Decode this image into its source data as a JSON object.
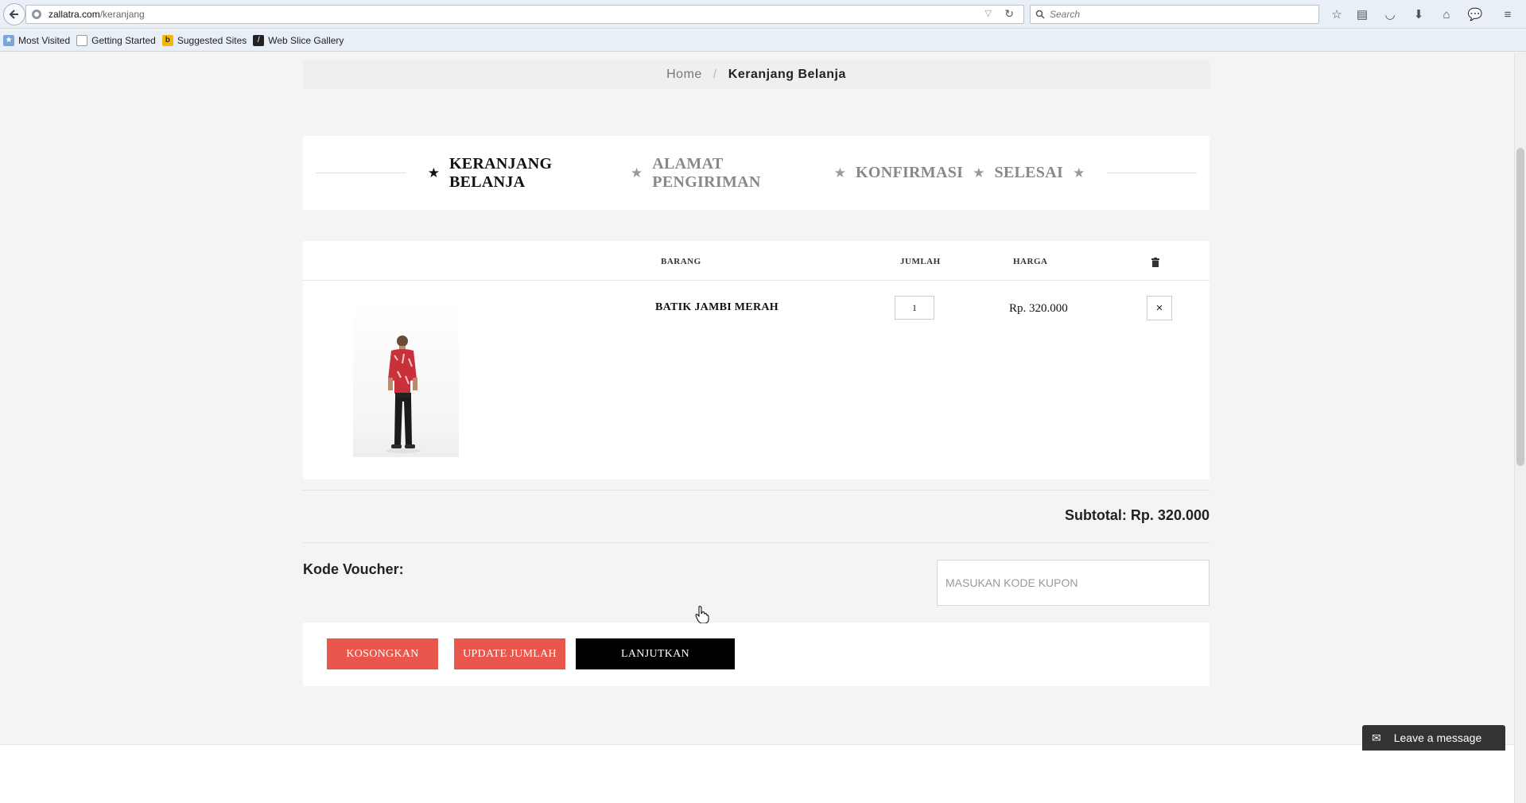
{
  "browser": {
    "url_host": "zallatra.com",
    "url_path": "/keranjang",
    "search_placeholder": "Search",
    "bookmarks": [
      "Most Visited",
      "Getting Started",
      "Suggested Sites",
      "Web Slice Gallery"
    ]
  },
  "breadcrumb": {
    "home": "Home",
    "separator": "/",
    "current": "Keranjang Belanja"
  },
  "steps": [
    {
      "label": "KERANJANG BELANJA",
      "active": true
    },
    {
      "label": "ALAMAT PENGIRIMAN",
      "active": false
    },
    {
      "label": "KONFIRMASI",
      "active": false
    },
    {
      "label": "SELESAI",
      "active": false
    }
  ],
  "cart": {
    "headers": {
      "item": "BARANG",
      "qty": "JUMLAH",
      "price": "HARGA"
    },
    "items": [
      {
        "name": "BATIK JAMBI MERAH",
        "qty": "1",
        "price": "Rp. 320.000"
      }
    ],
    "remove_symbol": "×"
  },
  "subtotal": "Subtotal: Rp. 320.000",
  "voucher": {
    "label": "Kode Voucher:",
    "placeholder": "MASUKAN KODE KUPON"
  },
  "actions": {
    "empty": "KOSONGKAN",
    "update": "UPDATE JUMLAH",
    "continue": "LANJUTKAN"
  },
  "chat": {
    "label": "Leave a message"
  },
  "colors": {
    "accent_red": "#e9564b",
    "primary_black": "#000000"
  }
}
